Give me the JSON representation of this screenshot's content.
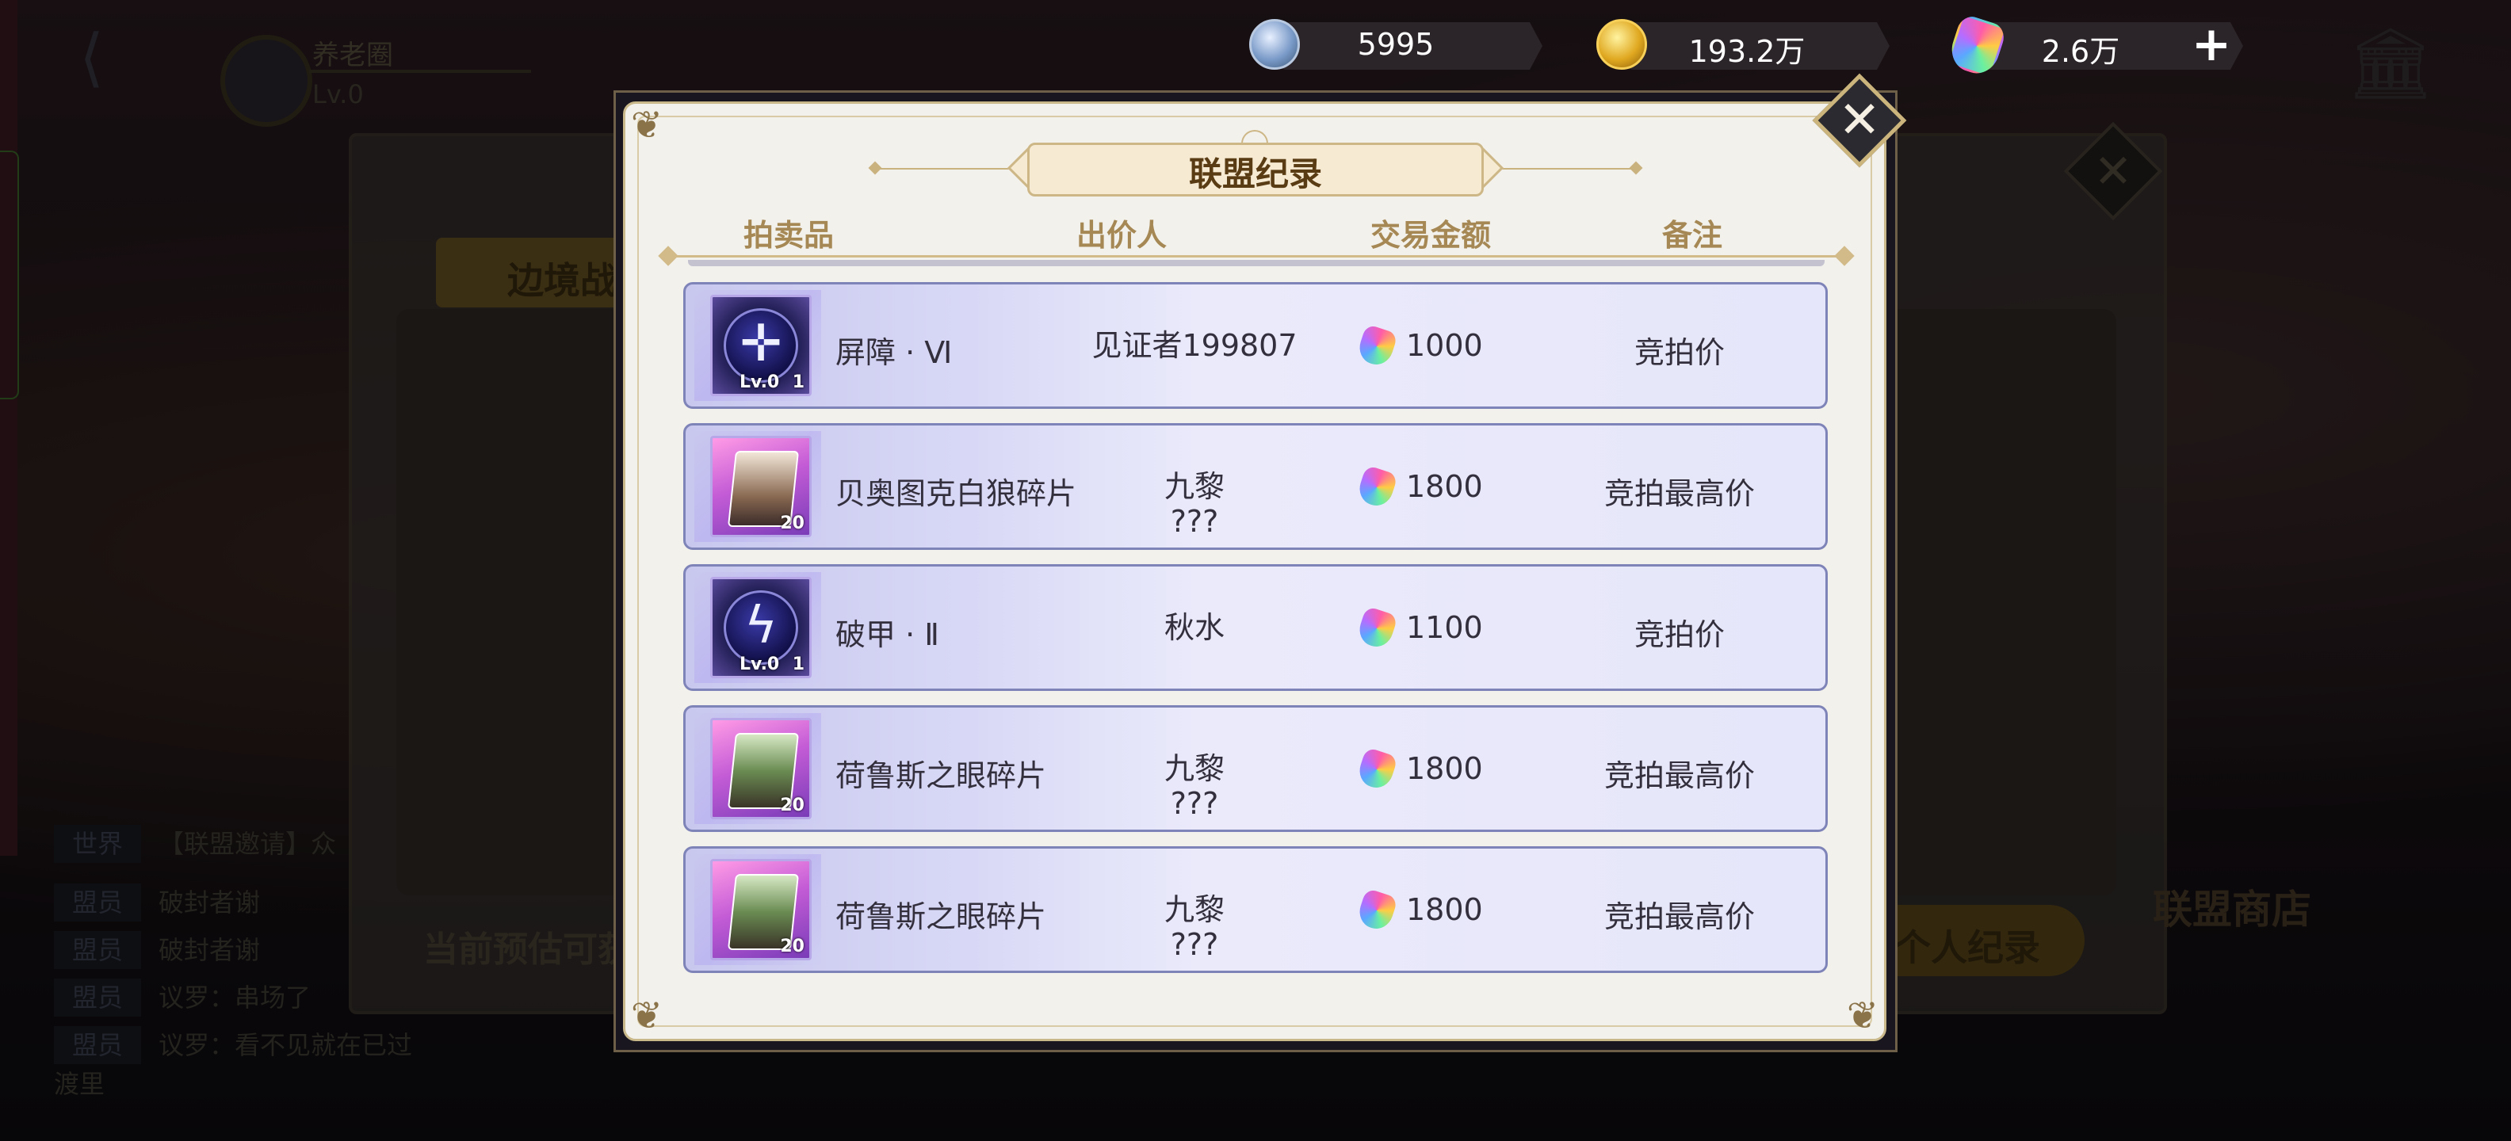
{
  "background": {
    "player_name": "养老圈",
    "player_level": "Lv.0",
    "tab_label": "边境战",
    "estimate_label": "当前预估可获",
    "record_button": "个人纪录",
    "shop_label": "联盟商店",
    "chat": [
      {
        "channel": "世界",
        "text": "【联盟邀请】众"
      },
      {
        "channel": "盟员",
        "text": "破封者谢"
      },
      {
        "channel": "盟员",
        "text": "破封者谢"
      },
      {
        "channel": "盟员",
        "text": "议罗：串场了"
      },
      {
        "channel": "盟员",
        "text": "议罗：看不见就在已过渡里"
      }
    ]
  },
  "currency": {
    "crystal": {
      "value": "5995",
      "icon": "crystal-coin-icon"
    },
    "gold": {
      "value": "193.2万",
      "icon": "gold-coin-icon"
    },
    "gem": {
      "value": "2.6万",
      "icon": "rainbow-gem-icon"
    },
    "add_button": "+"
  },
  "modal": {
    "title": "联盟纪录",
    "close_symbol": "✕",
    "columns": [
      "拍卖品",
      "出价人",
      "交易金额",
      "备注"
    ],
    "rows": [
      {
        "item": "屏障 · Ⅵ",
        "item_kind": "skill",
        "glyph": "✛",
        "level": "Lv.0",
        "count": "1",
        "bidder": "见证者199807",
        "price": "1000",
        "note": "竞拍价"
      },
      {
        "item": "贝奥图克白狼碎片",
        "item_kind": "fragment",
        "count": "20",
        "bidder": "九黎\n???",
        "price": "1800",
        "note": "竞拍最高价"
      },
      {
        "item": "破甲 · Ⅱ",
        "item_kind": "skill",
        "glyph": "ϟ",
        "level": "Lv.0",
        "count": "1",
        "bidder": "秋水",
        "price": "1100",
        "note": "竞拍价"
      },
      {
        "item": "荷鲁斯之眼碎片",
        "item_kind": "fragment",
        "count": "20",
        "bidder": "九黎\n???",
        "price": "1800",
        "note": "竞拍最高价"
      },
      {
        "item": "荷鲁斯之眼碎片",
        "item_kind": "fragment",
        "count": "20",
        "bidder": "九黎\n???",
        "price": "1800",
        "note": "竞拍最高价"
      }
    ]
  },
  "colors": {
    "modal_bg": "#f3f1ec",
    "row_bg": "#e6e6fa",
    "title_text": "#5a3c14",
    "header_text": "#a58854"
  }
}
